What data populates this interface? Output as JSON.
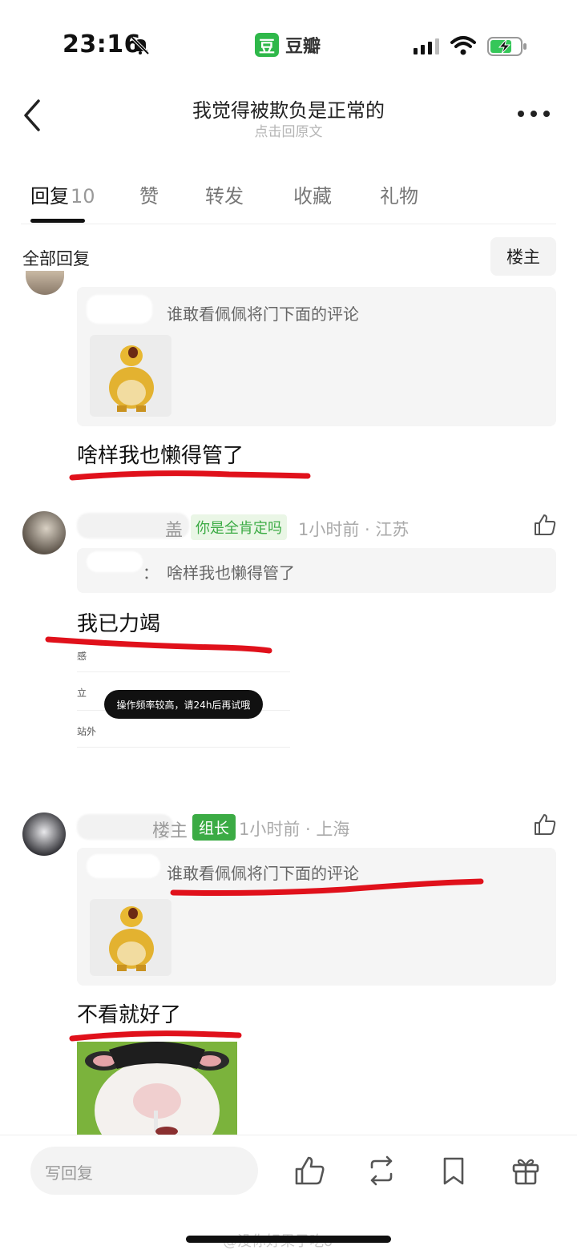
{
  "status_bar": {
    "time": "23:16",
    "app_logo_char": "豆",
    "app_name": "豆瓣"
  },
  "nav": {
    "title": "我觉得被欺负是正常的",
    "subtitle": "点击回原文"
  },
  "tabs": [
    {
      "label": "回复",
      "count": "10",
      "active": true
    },
    {
      "label": "赞"
    },
    {
      "label": "转发"
    },
    {
      "label": "收藏"
    },
    {
      "label": "礼物"
    }
  ],
  "filter": {
    "title": "全部回复",
    "op_button": "楼主"
  },
  "comments": [
    {
      "quote_text": "谁敢看佩佩将门下面的评论",
      "reply": "啥样我也懒得管了"
    },
    {
      "name_partial": "盖",
      "badge": "你是全肯定吗",
      "time": "1小时前 · 江苏",
      "quote_text": "啥样我也懒得管了",
      "quote_prefix": "：",
      "reply": "我已力竭",
      "popup_items": [
        "感",
        "立",
        "站外",
        ""
      ],
      "toast": "操作频率较高，请24h后再试哦"
    },
    {
      "name_partial": "楼主",
      "badge": "组长",
      "time": "1小时前 · 上海",
      "quote_text": "谁敢看佩佩将门下面的评论",
      "reply": "不看就好了"
    }
  ],
  "bottom": {
    "input_placeholder": "写回复",
    "watermark": "@没你好果子吃o"
  },
  "colors": {
    "accent_green": "#3bab44",
    "annotation_red": "#e0111b"
  }
}
